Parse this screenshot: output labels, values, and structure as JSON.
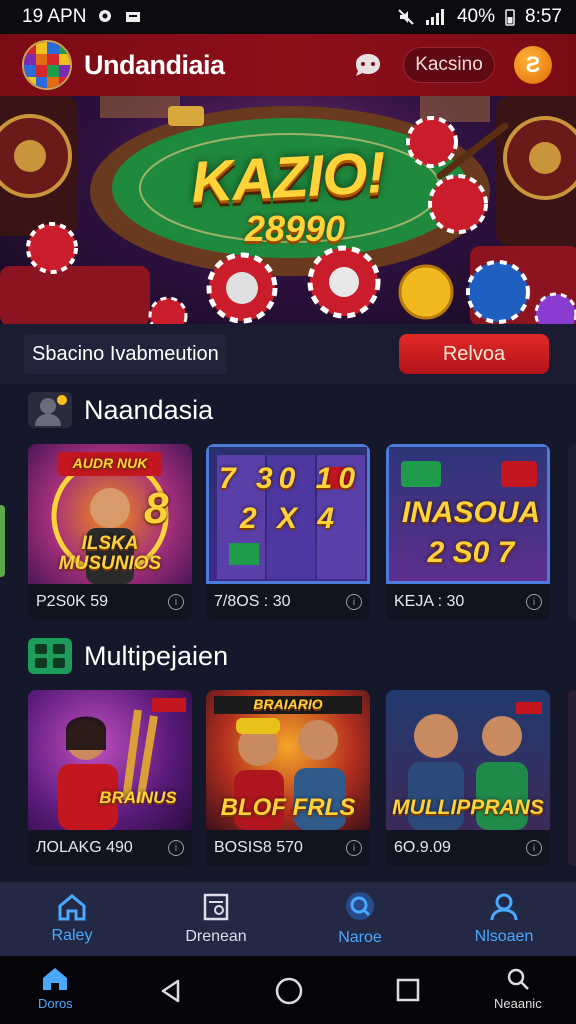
{
  "status_bar": {
    "time": "19 APN",
    "battery": "40%",
    "clock": "8:57"
  },
  "header": {
    "title": "Undandiaia",
    "casino_label": "Kacsino",
    "coin_symbol": "Ƨ"
  },
  "hero": {
    "title": "KAZIO!",
    "number": "28990"
  },
  "info_bar": {
    "text": "Sbacino Ivabmeution",
    "button_label": "Relvoa"
  },
  "section1": {
    "title": "Naandasia",
    "cards": [
      {
        "art_text": "ILSKA MUSUNIOS",
        "badge": "AUDR NUK",
        "footer": "P2S0K 59"
      },
      {
        "art_text": "7 30 10 2 X 4",
        "footer": "7/8OS : 30"
      },
      {
        "art_text": "INASOUA 2 S0 7",
        "footer": "KEJA : 30"
      }
    ]
  },
  "section2": {
    "title": "Multipejaien",
    "cards": [
      {
        "art_text": "BRAINUS",
        "footer": "ЛOLAKG 490"
      },
      {
        "art_text": "BLOF FRLS",
        "badge": "BRAIARIO",
        "footer": "BOSIS8 570"
      },
      {
        "art_text": "MULLIPPRANS",
        "footer": "6O.9.09"
      }
    ]
  },
  "app_nav": [
    {
      "label": "Raley"
    },
    {
      "label": "Drenean"
    },
    {
      "label": "Naroe"
    },
    {
      "label": "Nlsoaen"
    }
  ],
  "system_nav": {
    "home_label": "Doros",
    "search_label": "Neaanic"
  },
  "colors": {
    "brand_red": "#8d0f1a",
    "accent_blue": "#4ba8ff",
    "gold": "#ffd43a"
  }
}
